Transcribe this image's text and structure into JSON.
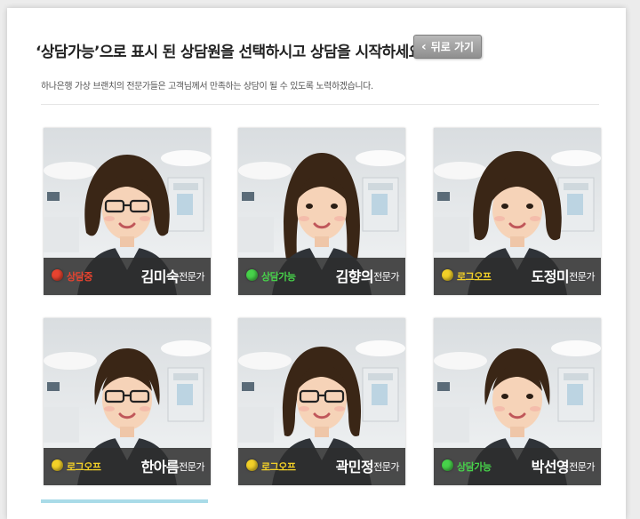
{
  "header": {
    "title": "‘상담가능’으로 표시 된 상담원을 선택하시고 상담을 시작하세요!",
    "back_label": "뒤로 가기",
    "subtitle": "하나은행 가상 브랜치의 전문가들은 고객님께서 만족하는 상담이 될 수 있도록 노력하겠습니다."
  },
  "status_colors": {
    "busy": "#e8432f",
    "available": "#47d24a",
    "logoff": "#f2d028"
  },
  "consultants": [
    {
      "name": "김미숙",
      "role": "전문가",
      "status": "상담중",
      "status_key": "busy",
      "glasses": true,
      "hair": "short-bob"
    },
    {
      "name": "김향의",
      "role": "전문가",
      "status": "상담가능",
      "status_key": "available",
      "glasses": false,
      "hair": "long"
    },
    {
      "name": "도정미",
      "role": "전문가",
      "status": "로그오프",
      "status_key": "logoff",
      "glasses": false,
      "hair": "bob"
    },
    {
      "name": "한아름",
      "role": "전문가",
      "status": "로그오프",
      "status_key": "logoff",
      "glasses": true,
      "hair": "short"
    },
    {
      "name": "곽민정",
      "role": "전문가",
      "status": "로그오프",
      "status_key": "logoff",
      "glasses": true,
      "hair": "medium"
    },
    {
      "name": "박선영",
      "role": "전문가",
      "status": "상담가능",
      "status_key": "available",
      "glasses": false,
      "hair": "short"
    }
  ]
}
